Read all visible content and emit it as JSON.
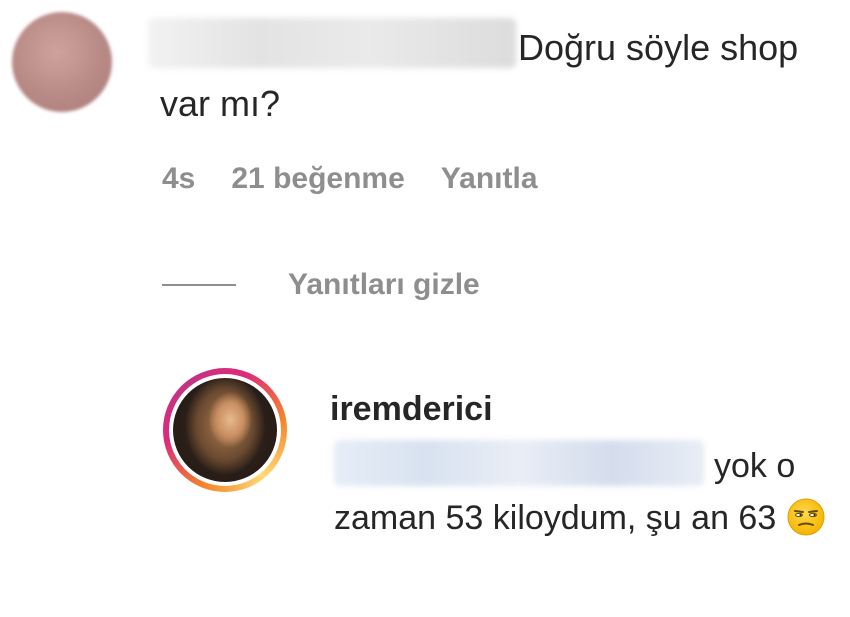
{
  "comment": {
    "text": "Doğru söyle shop var mı?",
    "time": "4s",
    "likes": "21 beğenme",
    "reply_label": "Yanıtla"
  },
  "replies_toggle": {
    "label": "Yanıtları gizle"
  },
  "reply": {
    "username": "iremderici",
    "text": "yok o zaman 53 kiloydum, şu an 63",
    "emoji": "unamused-face-icon"
  }
}
